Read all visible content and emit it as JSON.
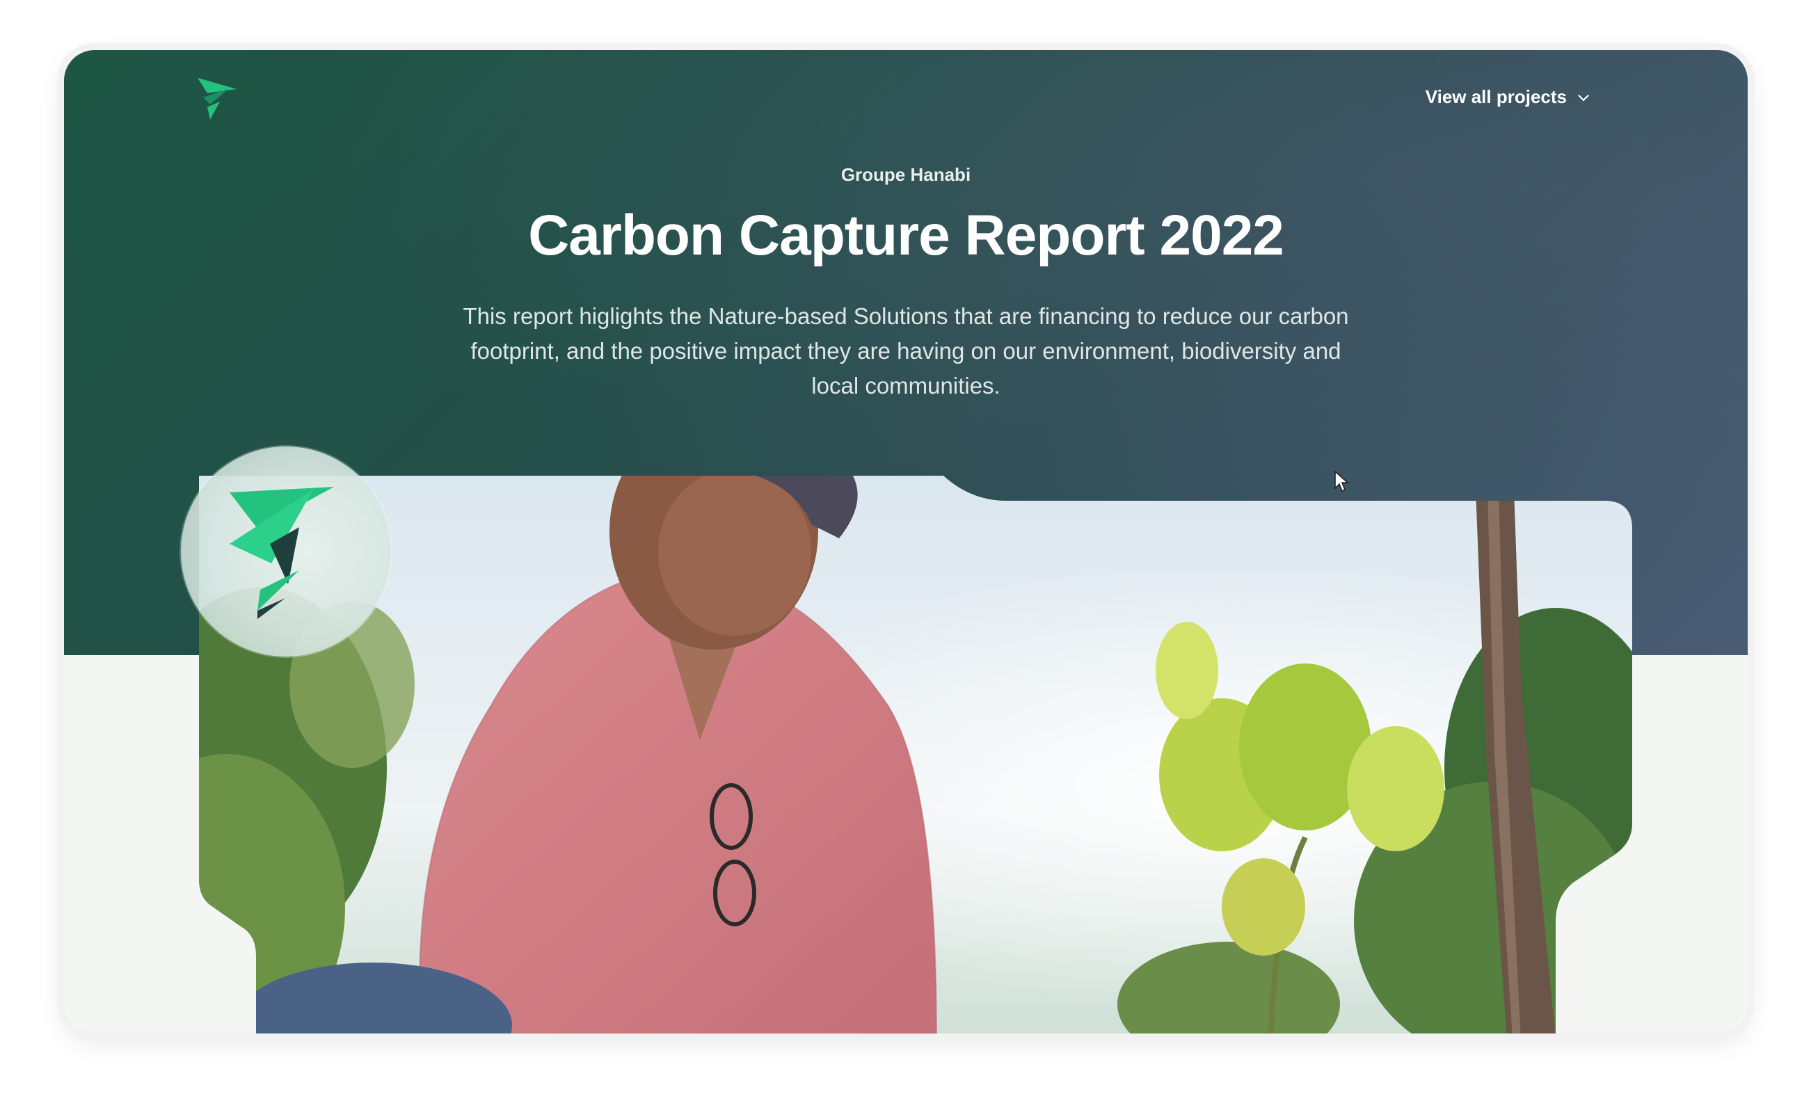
{
  "header": {
    "logo_icon": "hanabi-arrow-logo-icon",
    "nav_label": "View all projects",
    "nav_icon": "chevron-down-icon"
  },
  "hero": {
    "kicker": "Groupe Hanabi",
    "title": "Carbon Capture Report 2022",
    "description": "This report higlights the Nature-based Solutions that are financing to reduce our carbon footprint, and the positive impact they are having on our environment, biodiversity and local communities."
  },
  "media": {
    "photo_icon": "farmer-planting-seedling-photo",
    "badge_icon": "hanabi-arrow-badge-icon"
  },
  "colors": {
    "hero_green": "#1d5643",
    "hero_slate": "#4a5c75",
    "accent_green": "#23c37f",
    "page_background": "#f3f6f3"
  }
}
